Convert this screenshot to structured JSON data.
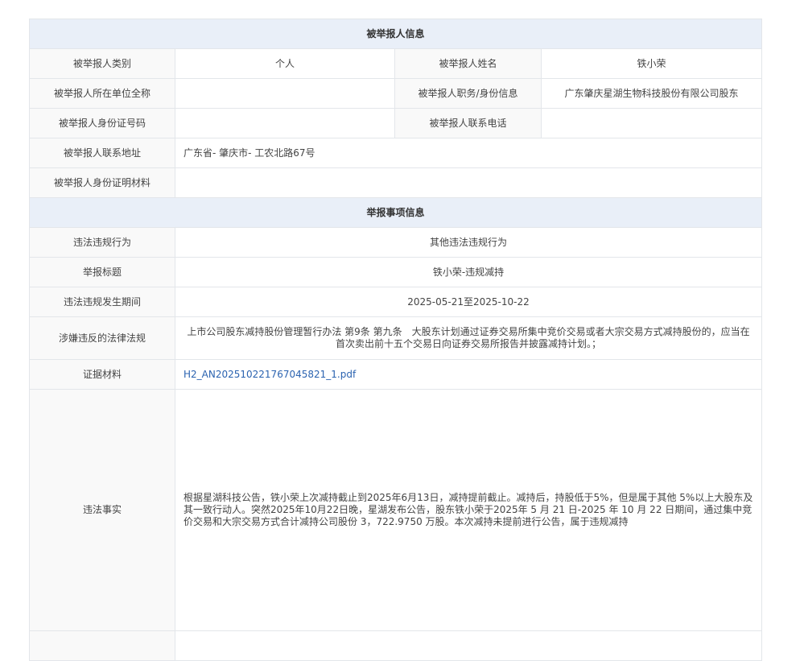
{
  "section1": {
    "title": "被举报人信息",
    "type_label": "被举报人类别",
    "type_value": "个人",
    "name_label": "被举报人姓名",
    "name_value": "铁小荣",
    "unit_label": "被举报人所在单位全称",
    "unit_value": "",
    "position_label": "被举报人职务/身份信息",
    "position_value": "广东肇庆星湖生物科技股份有限公司股东",
    "idno_label": "被举报人身份证号码",
    "idno_value": "",
    "phone_label": "被举报人联系电话",
    "phone_value": "",
    "address_label": "被举报人联系地址",
    "address_value": "广东省- 肇庆市- 工农北路67号",
    "idmaterial_label": "被举报人身份证明材料",
    "idmaterial_value": ""
  },
  "section2": {
    "title": "举报事项信息",
    "violation_label": "违法违规行为",
    "violation_value": "其他违法违规行为",
    "report_title_label": "举报标题",
    "report_title_value": "铁小荣-违规减持",
    "period_label": "违法违规发生期间",
    "period_value": "2025-05-21至2025-10-22",
    "law_label": "涉嫌违反的法律法规",
    "law_value": "上市公司股东减持股份管理暂行办法 第9条 第九条　大股东计划通过证券交易所集中竞价交易或者大宗交易方式减持股份的，应当在首次卖出前十五个交易日向证券交易所报告并披露减持计划。；",
    "evidence_label": "证据材料",
    "evidence_file": "H2_AN202510221767045821_1.pdf",
    "facts_label": "违法事实",
    "facts_value": "根据星湖科技公告，铁小荣上次减持截止到2025年6月13日，减持提前截止。减持后，持股低于5%，但是属于其他 5%以上大股东及其一致行动人。突然2025年10月22日晚，星湖发布公告，股东铁小荣于2025年 5 月 21 日-2025 年 10 月 22 日期间，通过集中竞价交易和大宗交易方式合计减持公司股份 3，722.9750 万股。本次减持未提前进行公告，属于违规减持"
  }
}
